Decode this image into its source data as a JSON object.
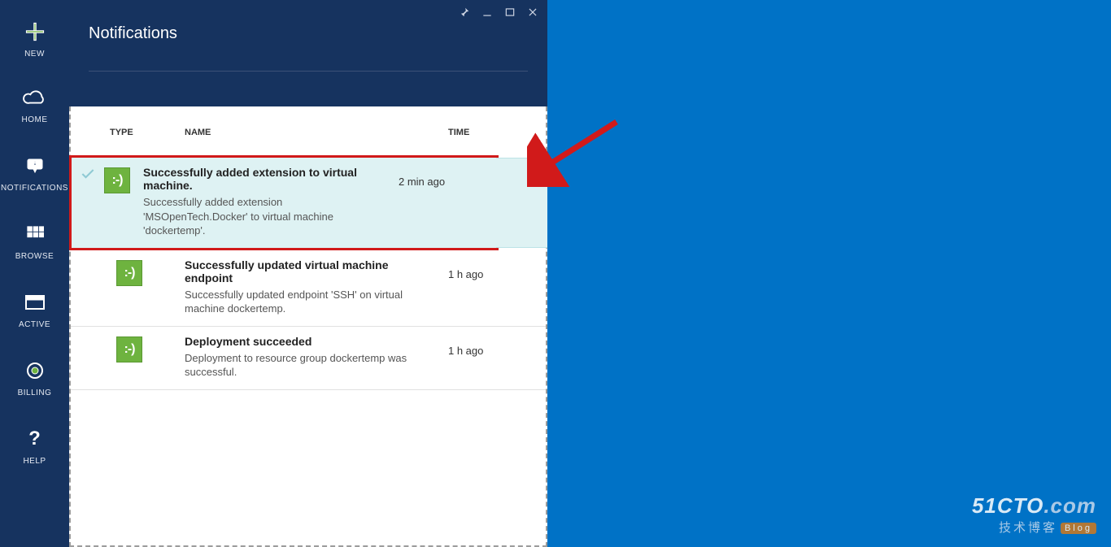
{
  "sidebar": {
    "items": [
      {
        "label": "NEW",
        "icon": "plus"
      },
      {
        "label": "HOME",
        "icon": "cloud"
      },
      {
        "label": "NOTIFICATIONS",
        "icon": "notification"
      },
      {
        "label": "BROWSE",
        "icon": "grid"
      },
      {
        "label": "ACTIVE",
        "icon": "window"
      },
      {
        "label": "BILLING",
        "icon": "coin"
      },
      {
        "label": "HELP",
        "icon": "question"
      }
    ]
  },
  "panel": {
    "title": "Notifications",
    "columns": {
      "type": "TYPE",
      "name": "NAME",
      "time": "TIME"
    },
    "notifications": [
      {
        "title": "Successfully added extension to virtual machine.",
        "desc": "Successfully added extension 'MSOpenTech.Docker' to virtual machine 'dockertemp'.",
        "time": "2 min ago",
        "badge": ":-)",
        "highlighted": true
      },
      {
        "title": "Successfully updated virtual machine endpoint",
        "desc": "Successfully updated endpoint 'SSH' on virtual machine dockertemp.",
        "time": "1 h ago",
        "badge": ":-)"
      },
      {
        "title": "Deployment succeeded",
        "desc": "Deployment to resource group dockertemp was successful.",
        "time": "1 h ago",
        "badge": ":-)"
      }
    ]
  },
  "watermark": {
    "line1a": "51CTO",
    "line1b": ".com",
    "line2": "技术博客",
    "badge": "Blog"
  }
}
